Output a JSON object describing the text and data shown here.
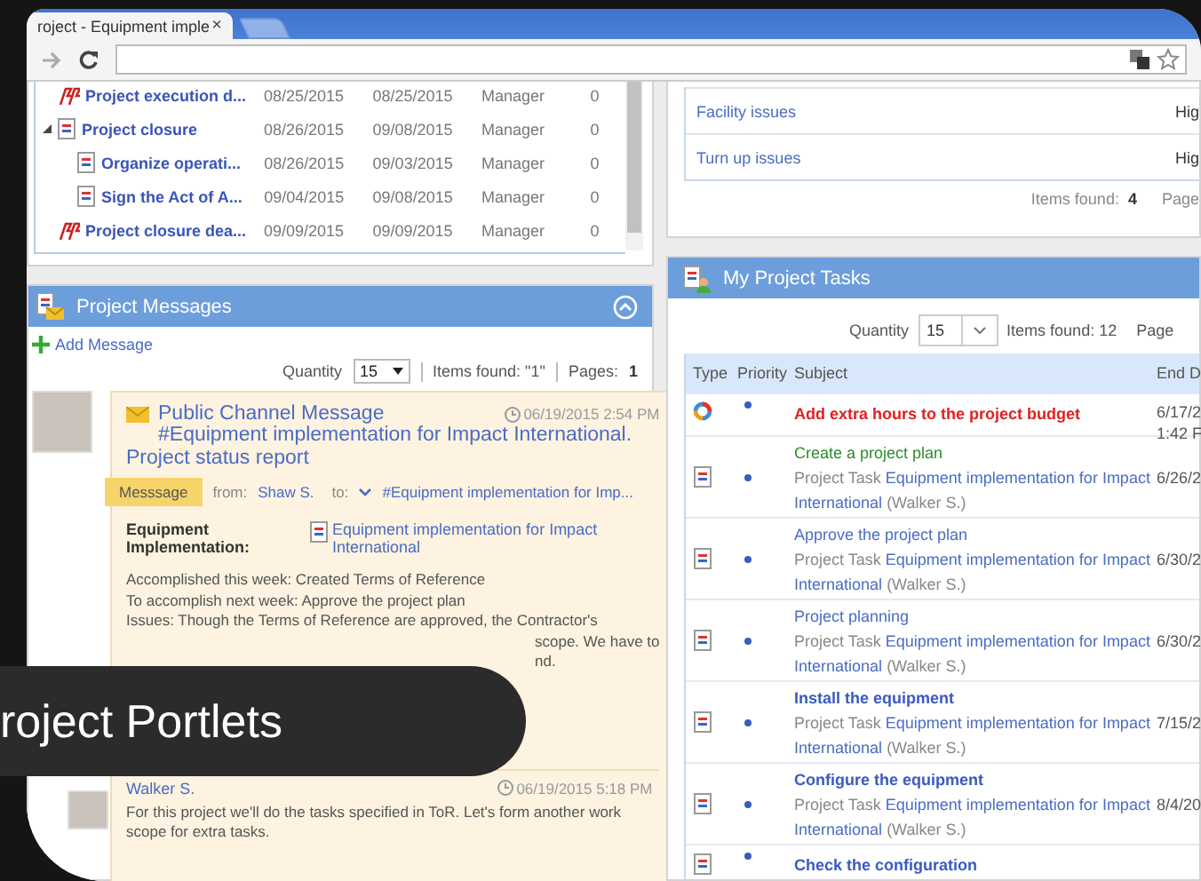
{
  "browser": {
    "tab_title": "roject - Equipment imple",
    "tab_close": "×"
  },
  "project_plan": {
    "rows": [
      {
        "kind": "milestone",
        "name": "Project execution d...",
        "start": "08/25/2015",
        "end": "08/25/2015",
        "role": "Manager",
        "count": "0"
      },
      {
        "kind": "task",
        "name": "Project closure",
        "start": "08/26/2015",
        "end": "09/08/2015",
        "role": "Manager",
        "count": "0",
        "expanded": true,
        "children": [
          {
            "kind": "task",
            "name": "Organize operati...",
            "start": "08/26/2015",
            "end": "09/03/2015",
            "role": "Manager",
            "count": "0"
          },
          {
            "kind": "task",
            "name": "Sign the Act of A...",
            "start": "09/04/2015",
            "end": "09/08/2015",
            "role": "Manager",
            "count": "0"
          }
        ]
      },
      {
        "kind": "milestone",
        "name": "Project closure dea...",
        "start": "09/09/2015",
        "end": "09/09/2015",
        "role": "Manager",
        "count": "0"
      }
    ]
  },
  "issues": {
    "rows": [
      {
        "name": "Facility issues",
        "priority": "Hig"
      },
      {
        "name": "Turn up issues",
        "priority": "Hig"
      }
    ],
    "items_found_label": "Items found:",
    "items_found": "4",
    "pages_label": "Page"
  },
  "messages": {
    "title": "Project Messages",
    "add": "Add Message",
    "quantity_label": "Quantity",
    "quantity": "15",
    "items_found": "Items found: \"1\"",
    "pages_label": "Pages:",
    "pages": "1",
    "message": {
      "title": "Public Channel Message",
      "date": "06/19/2015 2:54 PM",
      "subject": "#Equipment implementation for Impact International. Project status report",
      "tag": "Messsage",
      "from_label": "from:",
      "from": "Shaw S.",
      "to_label": "to:",
      "to": "#Equipment implementation for Imp...",
      "field_label": "Equipment Implementation:",
      "field_value": "Equipment implementation for Impact International",
      "body": [
        "Accomplished this week: Created Terms of Reference",
        "To accomplish next week: Approve the project plan",
        "Issues: Though the Terms of Reference are approved, the Contractor's"
      ],
      "body_fragments": [
        "scope. We have to",
        "nd."
      ]
    },
    "reply": {
      "author": "Walker S.",
      "date": "06/19/2015 5:18 PM",
      "text": "For this project we'll do the tasks specified in ToR. Let's form another work scope for extra tasks."
    }
  },
  "tasks": {
    "title": "My Project Tasks",
    "quantity_label": "Quantity",
    "quantity": "15",
    "items_found": "Items found: 12",
    "pages_label": "Page",
    "columns": [
      "Type",
      "Priority",
      "Subject",
      "End D"
    ],
    "rows": [
      {
        "kind": "issue",
        "title": "Add extra hours to the project budget",
        "color": "#e02020",
        "bold": true,
        "end": "6/17/2",
        "end_time": "1:42 F"
      },
      {
        "kind": "task",
        "title": "Create a project plan",
        "color": "#2e8b2e",
        "bold": false,
        "type_label": "Project Task",
        "project": "Equipment implementation for Impact International",
        "owner": "(Walker S.)",
        "end": "6/26/2"
      },
      {
        "kind": "task",
        "title": "Approve the project plan",
        "color": "#4a6cc4",
        "bold": false,
        "type_label": "Project Task",
        "project": "Equipment implementation for Impact International",
        "owner": "(Walker S.)",
        "end": "6/30/2"
      },
      {
        "kind": "task",
        "title": "Project planning",
        "color": "#4a6cc4",
        "bold": false,
        "type_label": "Project Task",
        "project": "Equipment implementation for Impact International",
        "owner": "(Walker S.)",
        "end": "6/30/2"
      },
      {
        "kind": "task",
        "title": "Install the equipment",
        "color": "#3a5bbf",
        "bold": true,
        "type_label": "Project Task",
        "project": "Equipment implementation for Impact International",
        "owner": "(Walker S.)",
        "end": "7/15/2"
      },
      {
        "kind": "task",
        "title": "Configure the equipment",
        "color": "#3a5bbf",
        "bold": true,
        "type_label": "Project Task",
        "project": "Equipment implementation for Impact International",
        "owner": "(Walker S.)",
        "end": "8/4/20"
      },
      {
        "kind": "task",
        "title": "Check the configuration",
        "color": "#3a5bbf",
        "bold": true
      }
    ]
  },
  "caption": "roject Portlets"
}
